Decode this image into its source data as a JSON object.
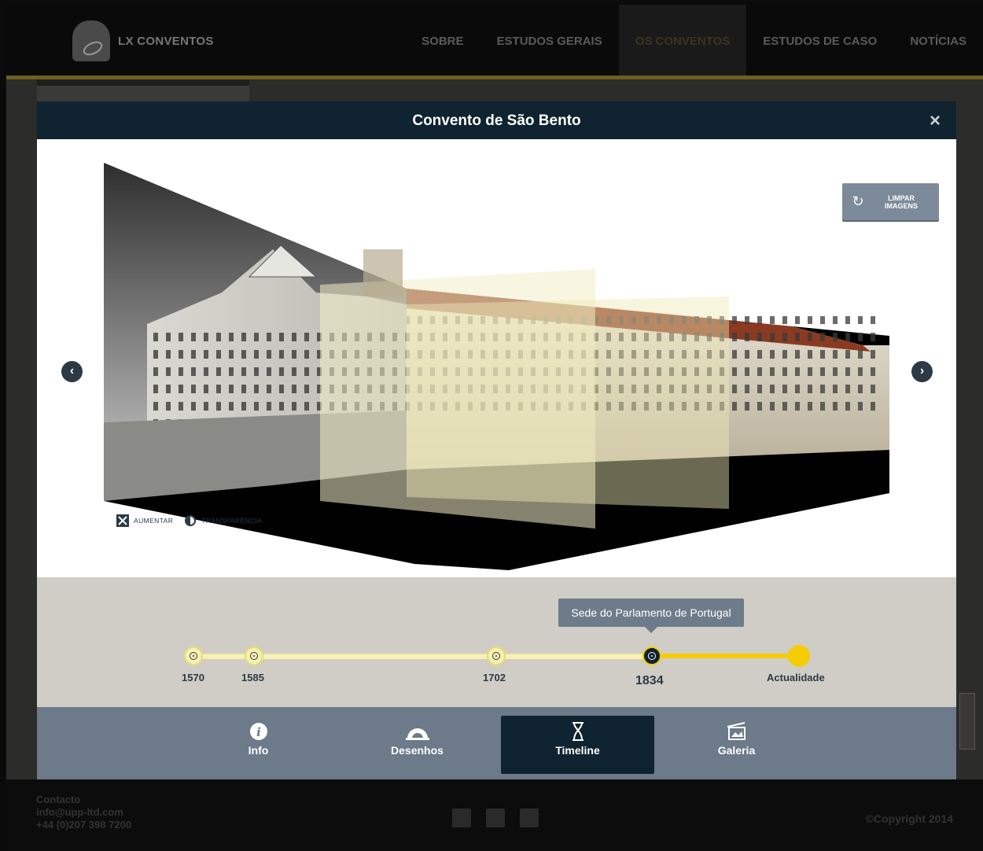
{
  "nav": {
    "brand": "LX CONVENTOS",
    "items": [
      {
        "label": "SOBRE"
      },
      {
        "label": "ESTUDOS GERAIS"
      },
      {
        "label": "OS CONVENTOS"
      },
      {
        "label": "ESTUDOS DE CASO"
      },
      {
        "label": "NOTÍCIAS"
      }
    ],
    "active_item": "OS CONVENTOS"
  },
  "modal": {
    "title": "Convento de São Bento",
    "close_label": "×",
    "clear_button": {
      "line1": "LIMPAR",
      "line2": "IMAGENS"
    },
    "tools": {
      "zoom_label": "AUMENTAR",
      "transparency_label": "TRANSPARÊNCIA"
    },
    "prev_label": "‹",
    "next_label": "›"
  },
  "timeline": {
    "tooltip": "Sede do Parlamento de Portugal",
    "points": [
      {
        "label": "1570"
      },
      {
        "label": "1585"
      },
      {
        "label": "1702"
      },
      {
        "label": "1834"
      },
      {
        "label": "Actualidade"
      }
    ],
    "active": "1834"
  },
  "tabs": [
    {
      "label": "Info",
      "icon": "info-icon"
    },
    {
      "label": "Desenhos",
      "icon": "protractor-icon"
    },
    {
      "label": "Timeline",
      "icon": "hourglass-icon"
    },
    {
      "label": "Galeria",
      "icon": "gallery-icon"
    }
  ],
  "active_tab": "Timeline",
  "footer": {
    "contact_title": "Contacto",
    "email": "info@upp-ltd.com",
    "phone": "+44 (0)207 398 7200",
    "copyright": "©Copyright 2014"
  },
  "colors": {
    "header": "#0f2330",
    "accent": "#f5cc05",
    "tabs_bg": "#6c7a8a",
    "timeline_bg": "#d0cdc6"
  }
}
